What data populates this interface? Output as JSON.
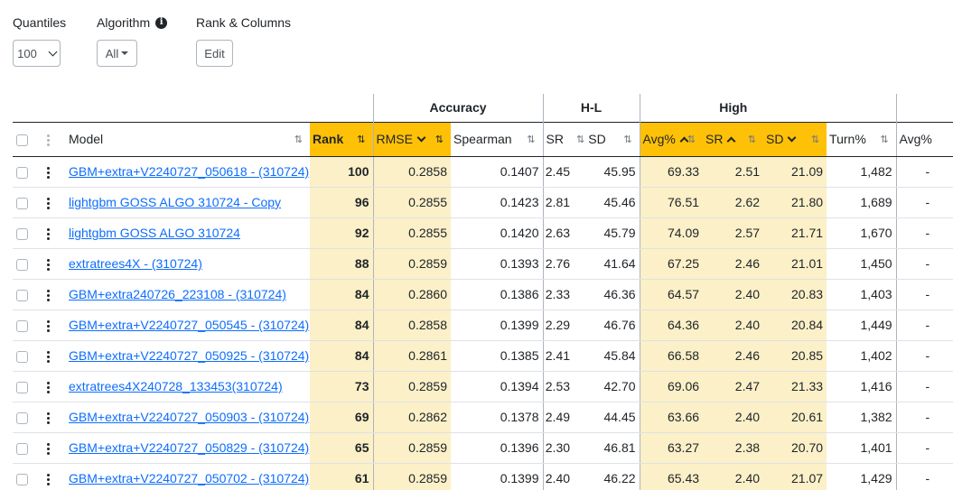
{
  "controls": {
    "quantiles": {
      "label": "Quantiles",
      "value": "100"
    },
    "algorithm": {
      "label": "Algorithm",
      "value": "All"
    },
    "rank_columns": {
      "label": "Rank & Columns",
      "button": "Edit"
    }
  },
  "groups": {
    "accuracy": "Accuracy",
    "hl": "H-L",
    "high": "High"
  },
  "columns": {
    "model": "Model",
    "rank": "Rank",
    "rmse": "RMSE",
    "spearman": "Spearman",
    "hl_sr": "SR",
    "hl_sd": "SD",
    "avg": "Avg%",
    "high_sr": "SR",
    "high_sd": "SD",
    "turn": "Turn%",
    "avg2": "Avg%"
  },
  "rows": [
    {
      "model": "GBM+extra+V2240727_050618 - (310724)",
      "rank": "100",
      "rmse": "0.2858",
      "spearman": "0.1407",
      "hl_sr": "2.45",
      "hl_sd": "45.95",
      "avg": "69.33",
      "high_sr": "2.51",
      "high_sd": "21.09",
      "turn": "1,482",
      "avg2": "-"
    },
    {
      "model": "lightgbm GOSS ALGO 310724 - Copy",
      "rank": "96",
      "rmse": "0.2855",
      "spearman": "0.1423",
      "hl_sr": "2.81",
      "hl_sd": "45.46",
      "avg": "76.51",
      "high_sr": "2.62",
      "high_sd": "21.80",
      "turn": "1,689",
      "avg2": "-"
    },
    {
      "model": "lightgbm GOSS ALGO 310724",
      "rank": "92",
      "rmse": "0.2855",
      "spearman": "0.1420",
      "hl_sr": "2.63",
      "hl_sd": "45.79",
      "avg": "74.09",
      "high_sr": "2.57",
      "high_sd": "21.71",
      "turn": "1,670",
      "avg2": "-"
    },
    {
      "model": "extratrees4X - (310724)",
      "rank": "88",
      "rmse": "0.2859",
      "spearman": "0.1393",
      "hl_sr": "2.76",
      "hl_sd": "41.64",
      "avg": "67.25",
      "high_sr": "2.46",
      "high_sd": "21.01",
      "turn": "1,450",
      "avg2": "-"
    },
    {
      "model": "GBM+extra240726_223108 - (310724)",
      "rank": "84",
      "rmse": "0.2860",
      "spearman": "0.1386",
      "hl_sr": "2.33",
      "hl_sd": "46.36",
      "avg": "64.57",
      "high_sr": "2.40",
      "high_sd": "20.83",
      "turn": "1,403",
      "avg2": "-"
    },
    {
      "model": "GBM+extra+V2240727_050545 - (310724)",
      "rank": "84",
      "rmse": "0.2858",
      "spearman": "0.1399",
      "hl_sr": "2.29",
      "hl_sd": "46.76",
      "avg": "64.36",
      "high_sr": "2.40",
      "high_sd": "20.84",
      "turn": "1,449",
      "avg2": "-"
    },
    {
      "model": "GBM+extra+V2240727_050925 - (310724)",
      "rank": "84",
      "rmse": "0.2861",
      "spearman": "0.1385",
      "hl_sr": "2.41",
      "hl_sd": "45.84",
      "avg": "66.58",
      "high_sr": "2.46",
      "high_sd": "20.85",
      "turn": "1,402",
      "avg2": "-"
    },
    {
      "model": "extratrees4X240728_133453(310724)",
      "rank": "73",
      "rmse": "0.2859",
      "spearman": "0.1394",
      "hl_sr": "2.53",
      "hl_sd": "42.70",
      "avg": "69.06",
      "high_sr": "2.47",
      "high_sd": "21.33",
      "turn": "1,416",
      "avg2": "-"
    },
    {
      "model": "GBM+extra+V2240727_050903 - (310724)",
      "rank": "69",
      "rmse": "0.2862",
      "spearman": "0.1378",
      "hl_sr": "2.49",
      "hl_sd": "44.45",
      "avg": "63.66",
      "high_sr": "2.40",
      "high_sd": "20.61",
      "turn": "1,382",
      "avg2": "-"
    },
    {
      "model": "GBM+extra+V2240727_050829 - (310724)",
      "rank": "65",
      "rmse": "0.2859",
      "spearman": "0.1396",
      "hl_sr": "2.30",
      "hl_sd": "46.81",
      "avg": "63.27",
      "high_sr": "2.38",
      "high_sd": "20.70",
      "turn": "1,401",
      "avg2": "-"
    },
    {
      "model": "GBM+extra+V2240727_050702 - (310724)",
      "rank": "61",
      "rmse": "0.2859",
      "spearman": "0.1399",
      "hl_sr": "2.40",
      "hl_sd": "46.22",
      "avg": "65.43",
      "high_sr": "2.40",
      "high_sd": "21.07",
      "turn": "1,429",
      "avg2": "-"
    }
  ]
}
